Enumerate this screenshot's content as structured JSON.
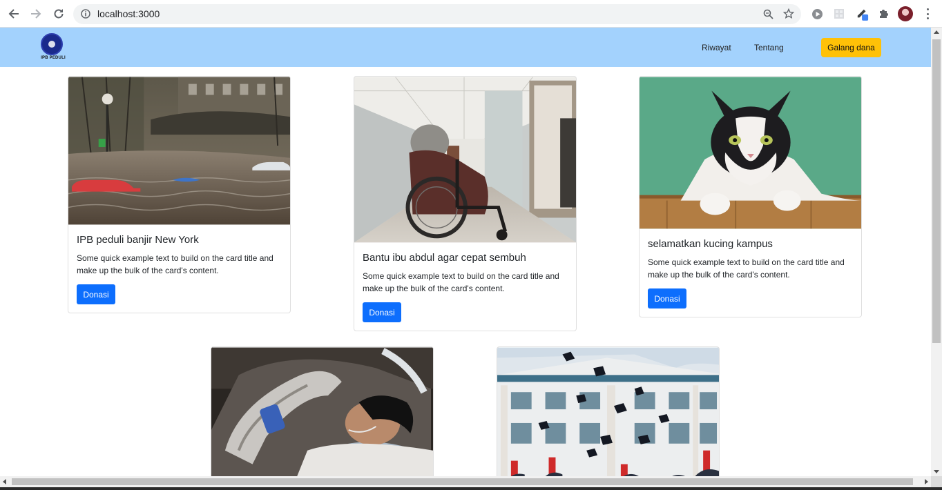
{
  "browser": {
    "url": "localhost:3000",
    "icons": [
      "back-icon",
      "forward-icon",
      "reload-icon",
      "info-icon",
      "zoom-icon",
      "bookmark-star-icon",
      "media-icon",
      "extension-grid-icon",
      "pen-extension-icon",
      "puzzle-extensions-icon",
      "profile-avatar",
      "menu-kebab-icon"
    ]
  },
  "navbar": {
    "brand_text": "IPB PEDULI",
    "links": [
      "Riwayat",
      "Tentang"
    ],
    "cta_label": "Galang dana",
    "colors": {
      "background": "#a3d2fd",
      "cta": "#ffc107"
    }
  },
  "cards": [
    {
      "title": "IPB peduli banjir New York",
      "text": "Some quick example text to build on the card title and make up the bulk of the card's content.",
      "button": "Donasi",
      "image": "flood-photo"
    },
    {
      "title": "Bantu ibu abdul agar cepat sembuh",
      "text": "Some quick example text to build on the card title and make up the bulk of the card's content.",
      "button": "Donasi",
      "image": "wheelchair-photo"
    },
    {
      "title": "selamatkan kucing kampus",
      "text": "Some quick example text to build on the card title and make up the bulk of the card's content.",
      "button": "Donasi",
      "image": "cat-photo"
    },
    {
      "image": "hospital-patient-photo"
    },
    {
      "image": "graduation-photo"
    }
  ],
  "colors": {
    "primary_button": "#0d6efd"
  }
}
